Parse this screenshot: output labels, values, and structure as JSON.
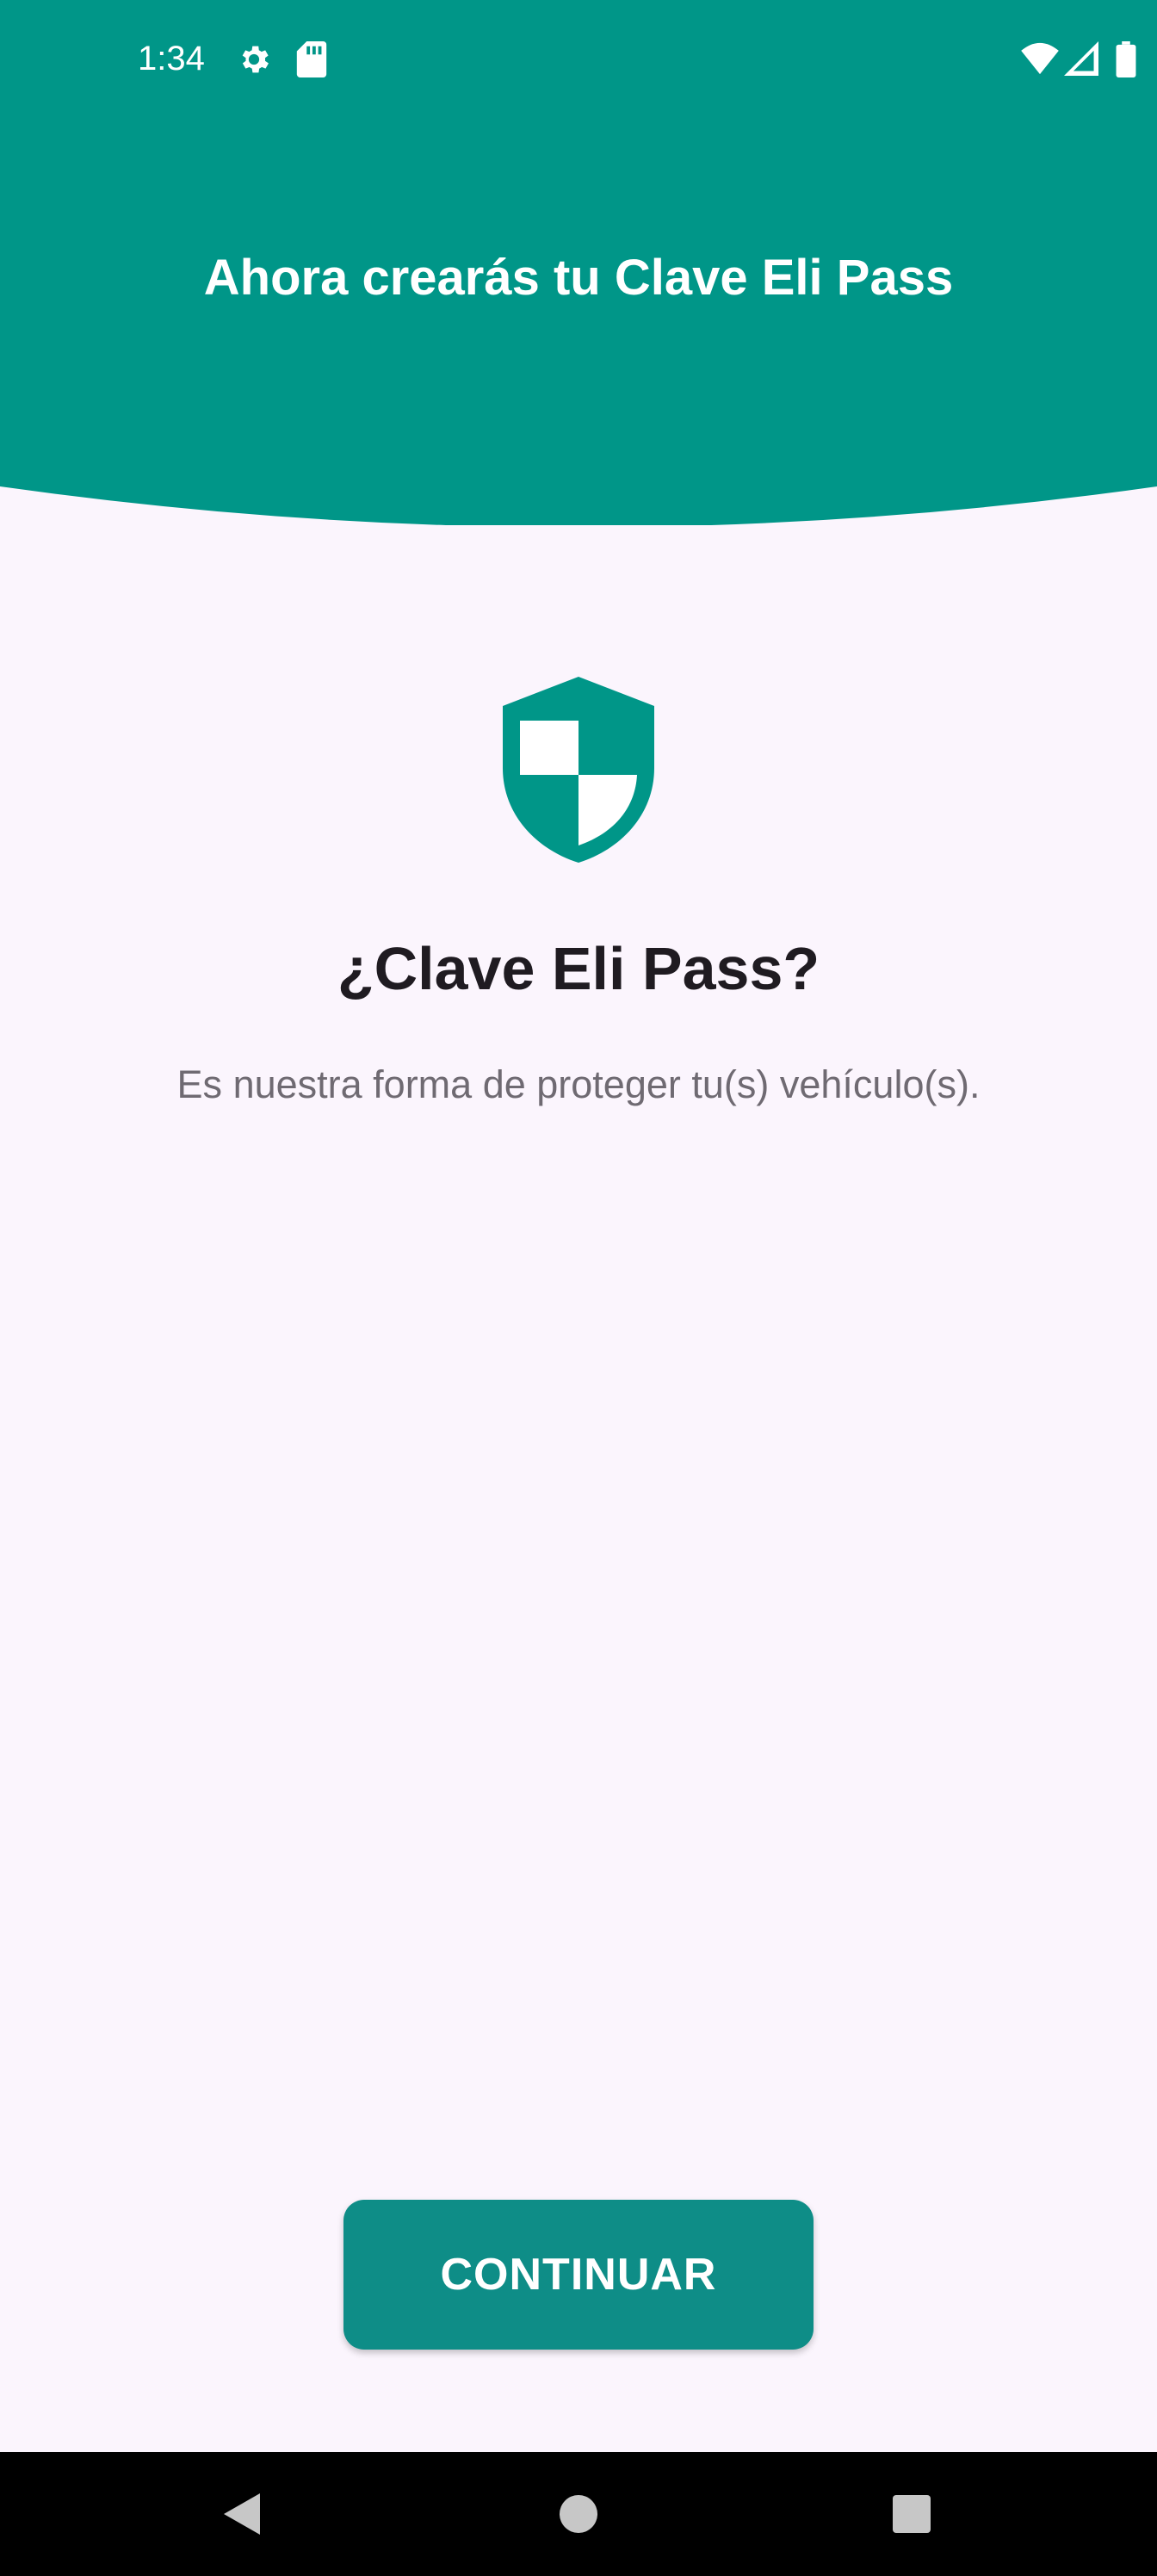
{
  "status_bar": {
    "time": "1:34",
    "icons": [
      "gear-icon",
      "sd-card-icon",
      "wifi-icon",
      "cellular-signal-icon",
      "battery-icon"
    ]
  },
  "header": {
    "title": "Ahora crearás tu Clave Eli Pass"
  },
  "content": {
    "icon": "shield-icon",
    "heading": "¿Clave Eli Pass?",
    "description": "Es nuestra forma de proteger tu(s) vehículo(s)."
  },
  "actions": {
    "continue_label": "CONTINUAR"
  },
  "navigation": {
    "buttons": [
      "back-icon",
      "home-icon",
      "recents-icon"
    ]
  },
  "colors": {
    "primary": "#009688",
    "button": "#0e8d87",
    "background": "#fbf5fd",
    "heading_text": "#1f1b21",
    "body_text": "#6f6a72"
  }
}
